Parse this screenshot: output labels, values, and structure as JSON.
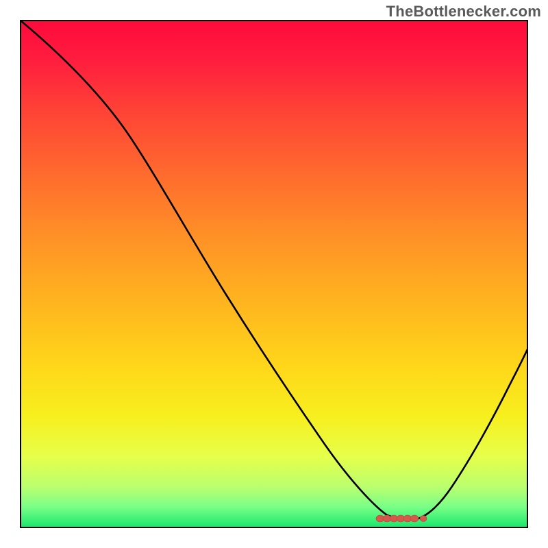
{
  "attribution": "TheBottlenecker.com",
  "chart_data": {
    "type": "line",
    "title": "",
    "xlabel": "",
    "ylabel": "",
    "xlim": [
      0,
      100
    ],
    "ylim": [
      0,
      100
    ],
    "x": [
      0,
      5,
      10,
      15,
      20,
      25,
      30,
      35,
      40,
      45,
      50,
      55,
      60,
      65,
      70,
      72,
      74,
      78,
      80,
      85,
      90,
      95,
      100
    ],
    "values": [
      100,
      95,
      90,
      84,
      78,
      72,
      62,
      52,
      44,
      36,
      28,
      20,
      13,
      8,
      3,
      2,
      2,
      4,
      7,
      14,
      22,
      30,
      38
    ],
    "minimum_marker": {
      "x_range": [
        68,
        78
      ],
      "y": 2
    },
    "background": "rainbow-vertical",
    "annotations": []
  }
}
